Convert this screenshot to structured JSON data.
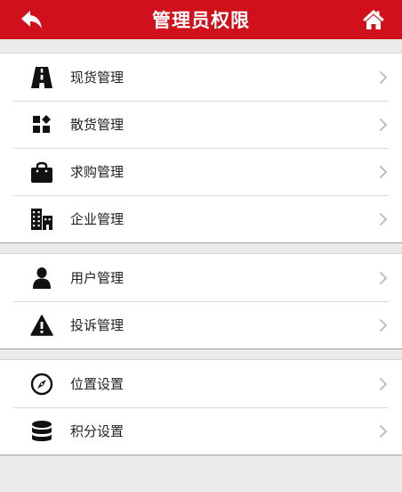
{
  "header": {
    "title": "管理员权限",
    "back_icon": "back-arrow-icon",
    "home_icon": "home-icon"
  },
  "groups": [
    {
      "items": [
        {
          "label": "现货管理",
          "icon": "road-icon"
        },
        {
          "label": "散货管理",
          "icon": "blocks-icon"
        },
        {
          "label": "求购管理",
          "icon": "shopping-bag-icon"
        },
        {
          "label": "企业管理",
          "icon": "buildings-icon"
        }
      ]
    },
    {
      "items": [
        {
          "label": "用户管理",
          "icon": "user-icon"
        },
        {
          "label": "投诉管理",
          "icon": "warning-icon"
        }
      ]
    },
    {
      "items": [
        {
          "label": "位置设置",
          "icon": "compass-icon"
        },
        {
          "label": "积分设置",
          "icon": "database-icon"
        }
      ]
    }
  ],
  "colors": {
    "header_bg": "#d0101b",
    "page_bg": "#ebebeb",
    "chevron": "#b8b8b8"
  }
}
